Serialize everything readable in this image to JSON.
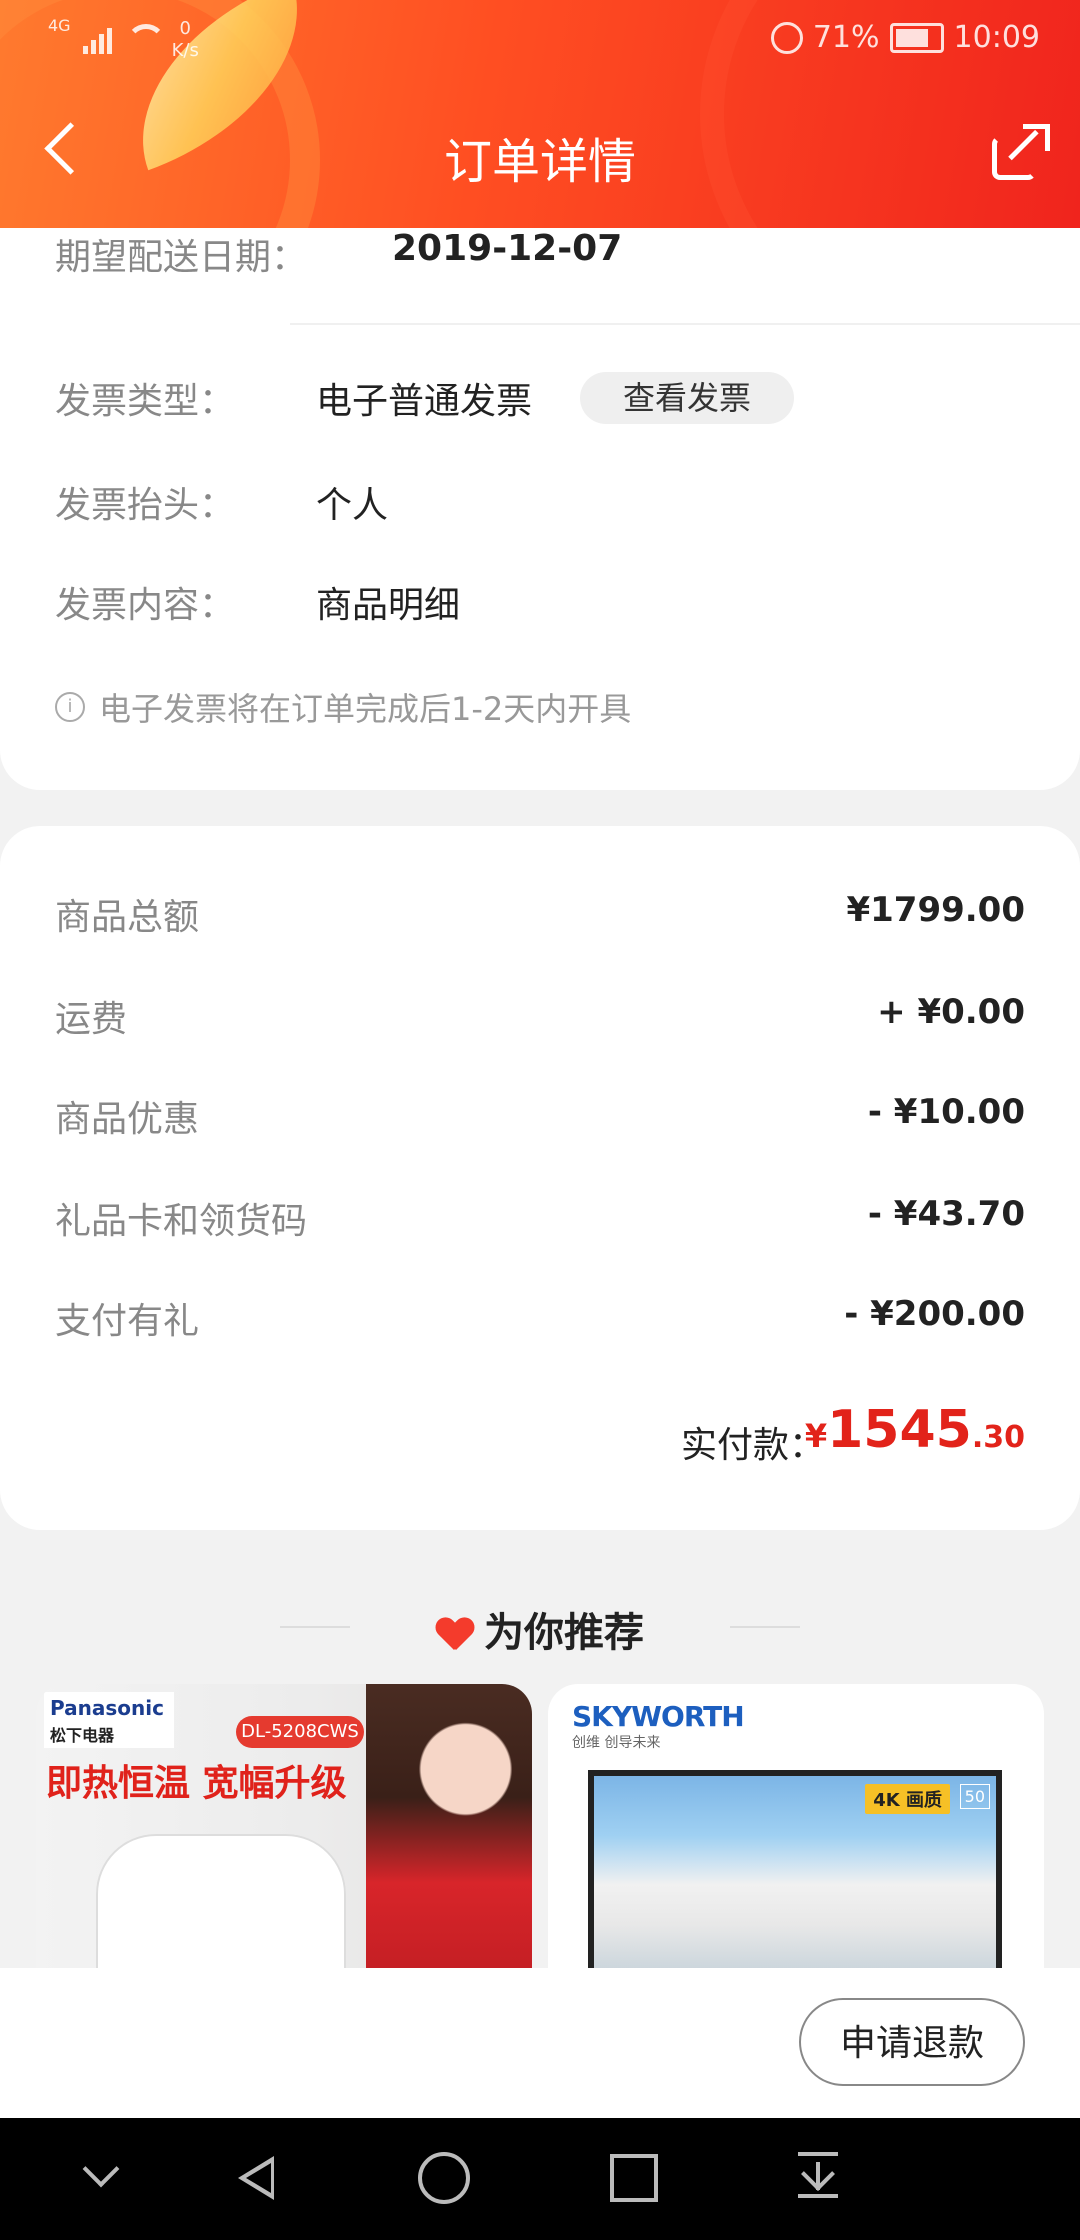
{
  "status_bar": {
    "network": "4G",
    "speed_value": "0",
    "speed_unit": "K/s",
    "battery": "71%",
    "time": "10:09"
  },
  "nav": {
    "title": "订单详情"
  },
  "delivery": {
    "label": "期望配送日期：",
    "value": "2019-12-07"
  },
  "invoice": {
    "type_label": "发票类型：",
    "type_value": "电子普通发票",
    "view_button": "查看发票",
    "title_label": "发票抬头：",
    "title_value": "个人",
    "content_label": "发票内容：",
    "content_value": "商品明细",
    "note": "电子发票将在订单完成后1-2天内开具"
  },
  "summary": {
    "rows": [
      {
        "label": "商品总额",
        "value": "¥1799.00"
      },
      {
        "label": "运费",
        "value": "+ ¥0.00"
      },
      {
        "label": "商品优惠",
        "value": "- ¥10.00"
      },
      {
        "label": "礼品卡和领货码",
        "value": "- ¥43.70"
      },
      {
        "label": "支付有礼",
        "value": "- ¥200.00"
      }
    ],
    "paid_label": "实付款：",
    "paid_currency": "¥",
    "paid_integer": "1545",
    "paid_decimal": ".30"
  },
  "recommend": {
    "title": "为你推荐",
    "products": [
      {
        "brand": "Panasonic",
        "brand_cn": "松下电器",
        "model": "DL-5208CWS",
        "slogan": "即热恒温 宽幅升级"
      },
      {
        "brand": "SKYWORTH",
        "brand_sub": "创维 创导未来",
        "badge": "4K 画质",
        "badge2": "50"
      }
    ]
  },
  "actions": {
    "refund_button": "申请退款"
  },
  "colors": {
    "accent": "#e2231a",
    "header_start": "#ff7a2e",
    "header_end": "#f0241d"
  }
}
